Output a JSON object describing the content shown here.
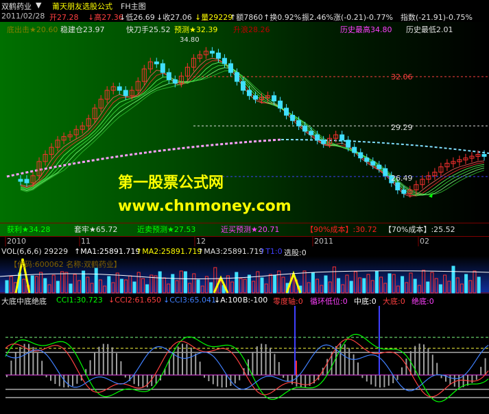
{
  "tabs": [
    {
      "label": "双鹤药业",
      "color": "#e0e0e0"
    },
    {
      "label": "▼",
      "color": "#e0e0e0"
    },
    {
      "label": "莆天朋友选股公式",
      "color": "#ffff00"
    },
    {
      "label": "FH主图",
      "color": "#e0e0e0"
    }
  ],
  "info": [
    {
      "text": "2011/02/28",
      "color": "#c0c0c0"
    },
    {
      "text": "开27.28",
      "color": "#ff4040"
    },
    {
      "text": "↓高27.36",
      "color": "#ff4040"
    },
    {
      "text": "↓低26.69",
      "color": "#e0e0e0"
    },
    {
      "text": "↓收27.06",
      "color": "#e0e0e0"
    },
    {
      "text": "↓量29229",
      "color": "#ffff00"
    },
    {
      "text": "↑额7860",
      "color": "#e0e0e0"
    },
    {
      "text": "↑换0.92%",
      "color": "#e0e0e0"
    },
    {
      "text": "振2.46%",
      "color": "#e0e0e0"
    },
    {
      "text": "涨(-0.21)-0.77%",
      "color": "#e0e0e0"
    },
    {
      "text": "指数(-21.91)-0.75%",
      "color": "#e0e0e0"
    }
  ],
  "main_labels": [
    {
      "text": "底出击★20.60",
      "color": "#808000"
    },
    {
      "text": "稳建仓23.97",
      "color": "#e0e0e0"
    },
    {
      "text": "快刀手25.52",
      "color": "#e0e0e0"
    },
    {
      "text": "预测★32.39",
      "color": "#ffff00"
    },
    {
      "text": "升浪28.26",
      "color": "#c00000"
    },
    {
      "text": "历史最高34.80",
      "color": "#ff40ff"
    },
    {
      "text": "历史最低2.01",
      "color": "#e0e0e0"
    }
  ],
  "price_levels": [
    {
      "text": "32.06",
      "color": "#ff4040"
    },
    {
      "text": "29.29",
      "color": "#e0e0e0"
    },
    {
      "text": "26.49",
      "color": "#e0e0e0"
    },
    {
      "text": "34.80",
      "color": "#e0e0e0"
    }
  ],
  "bottom_labels": [
    {
      "text": "获利★34.28",
      "color": "#00ff00"
    },
    {
      "text": "套牢★65.72",
      "color": "#e0e0e0"
    },
    {
      "text": "近卖预测★27.53",
      "color": "#00ff00"
    },
    {
      "text": "近买预测★20.71",
      "color": "#ff40ff"
    },
    {
      "text": "【90%成本】:30.72",
      "color": "#ff2020"
    },
    {
      "text": "【70%成本】:25.52",
      "color": "#e0e0e0"
    }
  ],
  "watermark": {
    "title": "第一股票公式网",
    "url": "www.chnmoney.com",
    "color": "#ffff00"
  },
  "time_axis": [
    "2010",
    "11",
    "12",
    "2011",
    "02"
  ],
  "volume_header": [
    {
      "text": "VOL(6,6,6) 29229",
      "color": "#e0e0e0"
    },
    {
      "text": "↑MA1:25891.719",
      "color": "#ffffff"
    },
    {
      "text": "↑MA2:25891.719",
      "color": "#ffff00"
    },
    {
      "text": "↑MA3:25891.719",
      "color": "#e0e0e0"
    },
    {
      "text": "↑T1:0",
      "color": "#4040ff"
    },
    {
      "text": "选股:0",
      "color": "#e0e0e0"
    }
  ],
  "volume_note": "【代码:600062 名称:双鹤药业】",
  "cci_header": [
    {
      "text": "大底中底绝底",
      "color": "#e0e0e0"
    },
    {
      "text": "CCI1:30.723",
      "color": "#00ff00"
    },
    {
      "text": "↓CCI2:61.650",
      "color": "#ff4040"
    },
    {
      "text": "↓CCI3:65.041",
      "color": "#4080ff"
    },
    {
      "text": "↓A:100",
      "color": "#ffffff"
    },
    {
      "text": "B:-100",
      "color": "#ffffff"
    },
    {
      "text": "零度轴:0",
      "color": "#ff4040"
    },
    {
      "text": "循环低位:0",
      "color": "#ff40ff"
    },
    {
      "text": "中底:0",
      "color": "#ffffff"
    },
    {
      "text": "大底:0",
      "color": "#ff4040"
    },
    {
      "text": "绝底:0",
      "color": "#ff40ff"
    }
  ],
  "colors": {
    "up": "#ff3030",
    "down": "#40e0ff",
    "bg_main": "#005000",
    "grid": "#800000"
  }
}
